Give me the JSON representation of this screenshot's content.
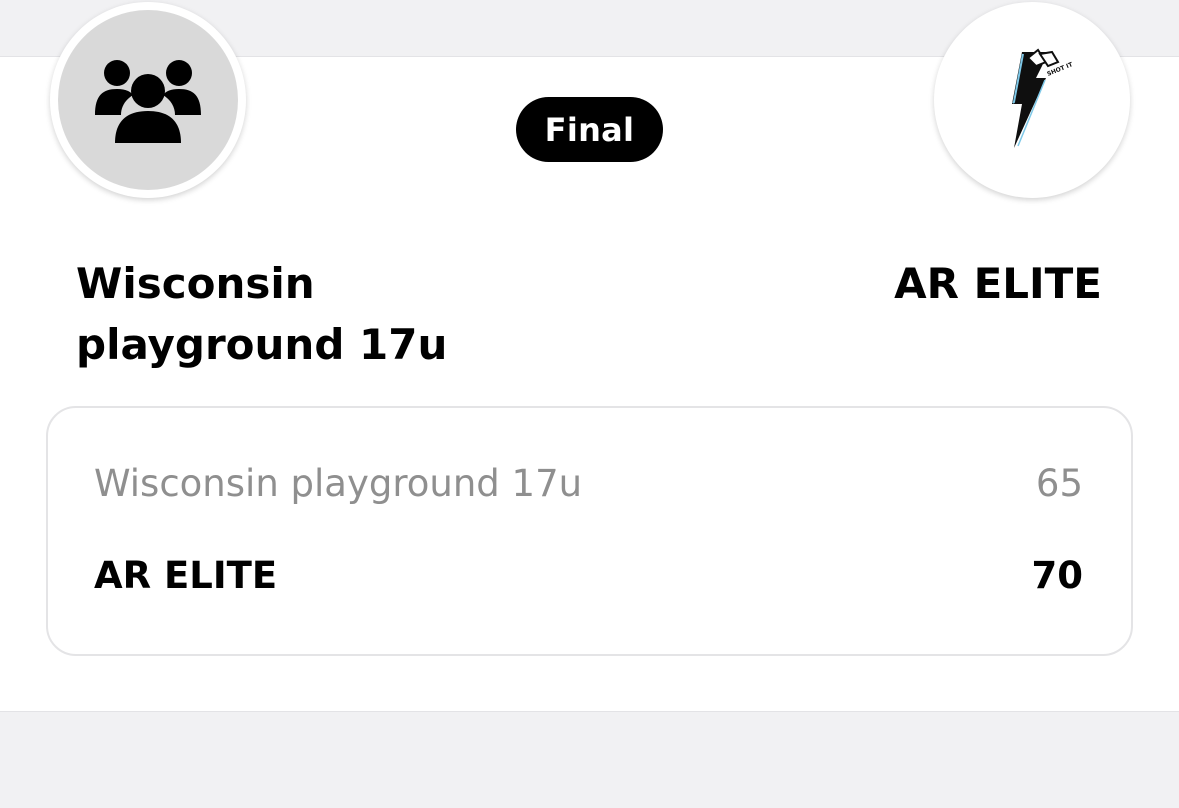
{
  "game": {
    "status": "Final"
  },
  "home": {
    "name_header": "Wisconsin playground 17u",
    "name_row": "Wisconsin playground 17u",
    "score": "65",
    "logo_icon": "team-group-icon"
  },
  "away": {
    "name_header": "AR ELITE",
    "name_row": "AR ELITE",
    "score": "70",
    "logo_icon": "ar-elite-lightning-logo",
    "logo_text": "SHOT IT"
  },
  "colors": {
    "page_background": "#f1f1f3",
    "card_background": "#ffffff",
    "status_pill": "#000000",
    "loser_text": "#8f8f8f",
    "winner_text": "#000000"
  }
}
